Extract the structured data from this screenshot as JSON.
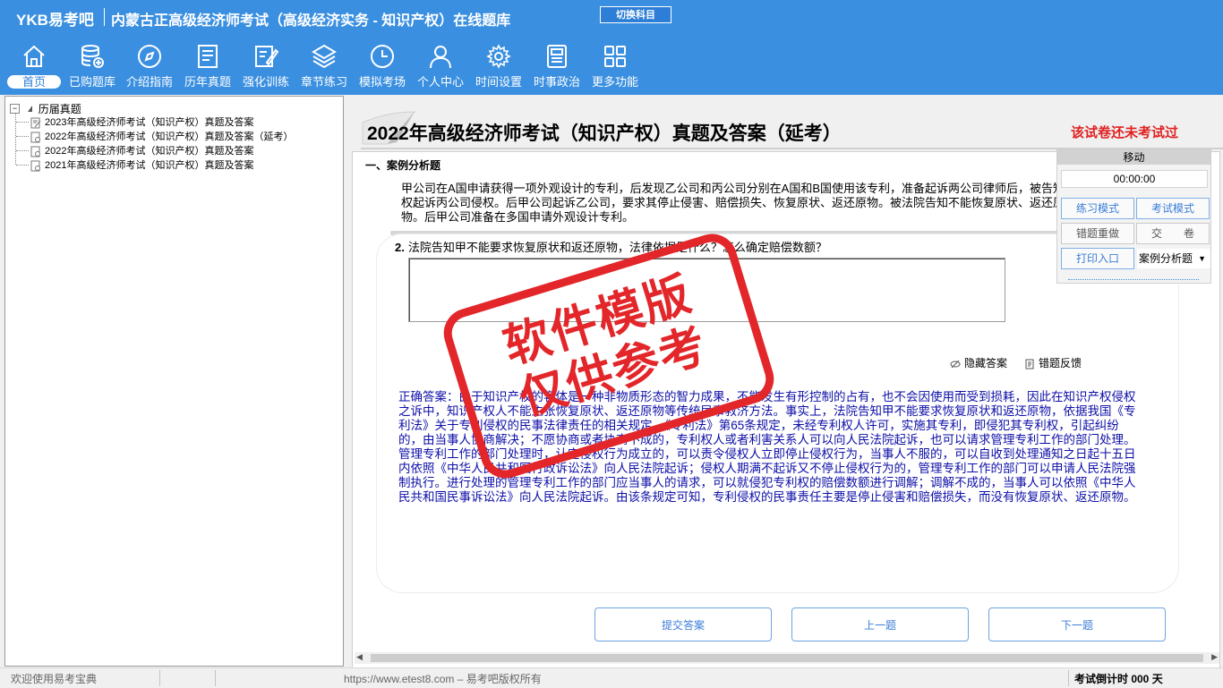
{
  "header": {
    "logo": "YKB易考吧",
    "title": "内蒙古正高级经济师考试（高级经济实务 - 知识产权）在线题库",
    "switch_subject": "切换科目"
  },
  "nav": [
    {
      "label": "首页",
      "icon": "home-icon"
    },
    {
      "label": "已购题库",
      "icon": "database-icon"
    },
    {
      "label": "介绍指南",
      "icon": "compass-icon"
    },
    {
      "label": "历年真题",
      "icon": "document-list-icon"
    },
    {
      "label": "强化训练",
      "icon": "edit-icon"
    },
    {
      "label": "章节练习",
      "icon": "layers-icon"
    },
    {
      "label": "模拟考场",
      "icon": "clock-icon"
    },
    {
      "label": "个人中心",
      "icon": "user-icon"
    },
    {
      "label": "时间设置",
      "icon": "gear-icon"
    },
    {
      "label": "时事政治",
      "icon": "newspaper-icon"
    },
    {
      "label": "更多功能",
      "icon": "grid-icon"
    }
  ],
  "tree": {
    "root": "历届真题",
    "items": [
      "2023年高级经济师考试（知识产权）真题及答案",
      "2022年高级经济师考试（知识产权）真题及答案（延考）",
      "2022年高级经济师考试（知识产权）真题及答案",
      "2021年高级经济师考试（知识产权）真题及答案"
    ]
  },
  "paper": {
    "title": "2022年高级经济师考试（知识产权）真题及答案（延考）",
    "status": "该试卷还未考试过"
  },
  "section": {
    "title": "一、案例分析题",
    "stem": "甲公司在A国申请获得一项外观设计的专利，后发现乙公司和丙公司分别在A国和B国使用该专利，准备起诉两公司律师后，被告知无权起诉丙公司侵权。后甲公司起诉乙公司，要求其停止侵害、赔偿损失、恢复原状、返还原物。被法院告知不能恢复原状、返还原物。后甲公司准备在多国申请外观设计专利。"
  },
  "question": {
    "number": "2.",
    "text": "法院告知甲不能要求恢复原状和返还原物，法律依据是什么？怎么确定赔偿数额？",
    "hide_answer": "隐藏答案",
    "feedback": "错题反馈",
    "correct_answer": "正确答案：由于知识产权的客体是一种非物质形态的智力成果，不能发生有形控制的占有，也不会因使用而受到损耗，因此在知识产权侵权之诉中，知识产权人不能主张恢复原状、返还原物等传统民事救济方法。事实上，法院告知甲不能要求恢复原状和返还原物，依据我国《专利法》关于专利侵权的民事法律责任的相关规定。《专利法》第65条规定，未经专利权人许可，实施其专利，即侵犯其专利权，引起纠纷的，由当事人协商解决；不愿协商或者协商不成的，专利权人或者利害关系人可以向人民法院起诉，也可以请求管理专利工作的部门处理。管理专利工作的部门处理时，认定侵权行为成立的，可以责令侵权人立即停止侵权行为，当事人不服的，可以自收到处理通知之日起十五日内依照《中华人民共和国行政诉讼法》向人民法院起诉；侵权人期满不起诉又不停止侵权行为的，管理专利工作的部门可以申请人民法院强制执行。进行处理的管理专利工作的部门应当事人的请求，可以就侵犯专利权的赔偿数额进行调解；调解不成的，当事人可以依照《中华人民共和国民事诉讼法》向人民法院起诉。由该条规定可知，专利侵权的民事责任主要是停止侵害和赔偿损失，而没有恢复原状、返还原物。"
  },
  "buttons": {
    "submit": "提交答案",
    "prev": "上一题",
    "next": "下一题"
  },
  "panel": {
    "move": "移动",
    "timer": "00:00:00",
    "practice_mode": "练习模式",
    "exam_mode": "考试模式",
    "redo_wrong": "错题重做",
    "hand_in": "交　　卷",
    "print": "打印入口",
    "question_type": "案例分析题"
  },
  "statusbar": {
    "welcome": "欢迎使用易考宝典",
    "copyright": "https://www.etest8.com – 易考吧版权所有",
    "countdown": "考试倒计时 000 天"
  },
  "watermark": {
    "line1": "软件模版",
    "line2": "仅供参考"
  },
  "colors": {
    "header_bg": "#3a8fe0",
    "answer_text": "#0d0ea7",
    "status_red": "#e02020",
    "stamp_red": "#e2262a"
  }
}
